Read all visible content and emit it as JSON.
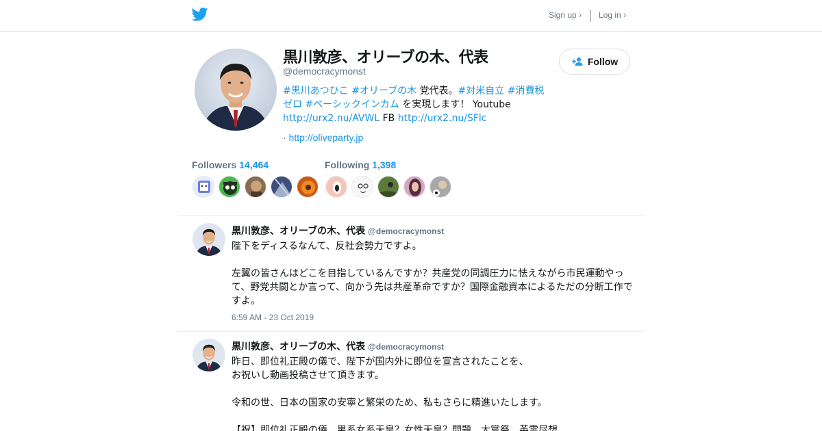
{
  "header": {
    "logo_icon": "twitter-bird-icon",
    "signup_label": "Sign up ›",
    "login_label": "Log in ›",
    "accent": "#1da1f2"
  },
  "profile": {
    "name": "黒川敦彦、オリーブの木、代表",
    "handle": "@democracymonst",
    "follow_label": "Follow",
    "follow_icon": "add-person-icon",
    "bio": {
      "hashtag1": "#黒川あつひこ",
      "hashtag2": "#オリーブの木",
      "text1": " 党代表。",
      "hashtag3": "#対米自立",
      "hashtag4": "#消費税ゼロ",
      "hashtag5": "#ベーシックインカム",
      "text2": " を実現します！ Youtube ",
      "link1": "http://urx2.nu/AVWL",
      "text3": "  FB ",
      "link2": "http://urx2.nu/SFlc"
    },
    "website_prefix": "· ",
    "website": "http://oliveparty.jp"
  },
  "stats": {
    "followers_label": "Followers",
    "followers_count": "14,464",
    "following_label": "Following",
    "following_count": "1,398"
  },
  "tweets": [
    {
      "name": "黒川敦彦、オリーブの木、代表",
      "handle": "@democracymonst",
      "text": "陛下をディスるなんて、反社会勢力ですよ。\n\n左翼の皆さんはどこを目指しているんですか？共産党の同調圧力に怯えながら市民運動やって、野党共闘とか言って、向かう先は共産革命ですか？国際金融資本によるただの分断工作ですよ。",
      "time": "6:59 AM - 23 Oct 2019"
    },
    {
      "name": "黒川敦彦、オリーブの木、代表",
      "handle": "@democracymonst",
      "text": "昨日、即位礼正殿の儀で、陛下が国内外に即位を宣言されたことを、\nお祝いし動画投稿させて頂きます。\n\n令和の世、日本の国家の安寧と繁栄のため、私もさらに精進いたします。\n\n【祝】即位礼正殿の儀　男系女系天皇？女性天皇？問題　大嘗祭　英霊尽想"
    }
  ]
}
